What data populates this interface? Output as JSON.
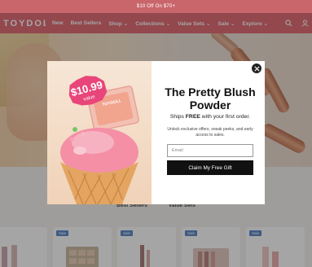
{
  "announcement": "$10 Off On $70+",
  "header": {
    "logo": "TOYDOLL",
    "nav": [
      "New",
      "Best Sellers",
      "Shop",
      "Collections",
      "Value Sets",
      "Sale",
      "Explore"
    ],
    "brand_color": "#e05f6a"
  },
  "page": {
    "tabs": [
      "Best Sellers",
      "Value Sets"
    ],
    "badge_label": "Sale"
  },
  "modal": {
    "promo_badge": "$10.99",
    "promo_sub": "value",
    "compact_label": "TOYDOLL",
    "title": "The Pretty Blush Powder",
    "subtitle_pre": "Ships ",
    "subtitle_bold": "FREE",
    "subtitle_post": " with your first order.",
    "description": "Unlock exclusive offers, sneak peeks, and early access to sales.",
    "email_placeholder": "Email",
    "cta_label": "Claim My Free Gift"
  }
}
